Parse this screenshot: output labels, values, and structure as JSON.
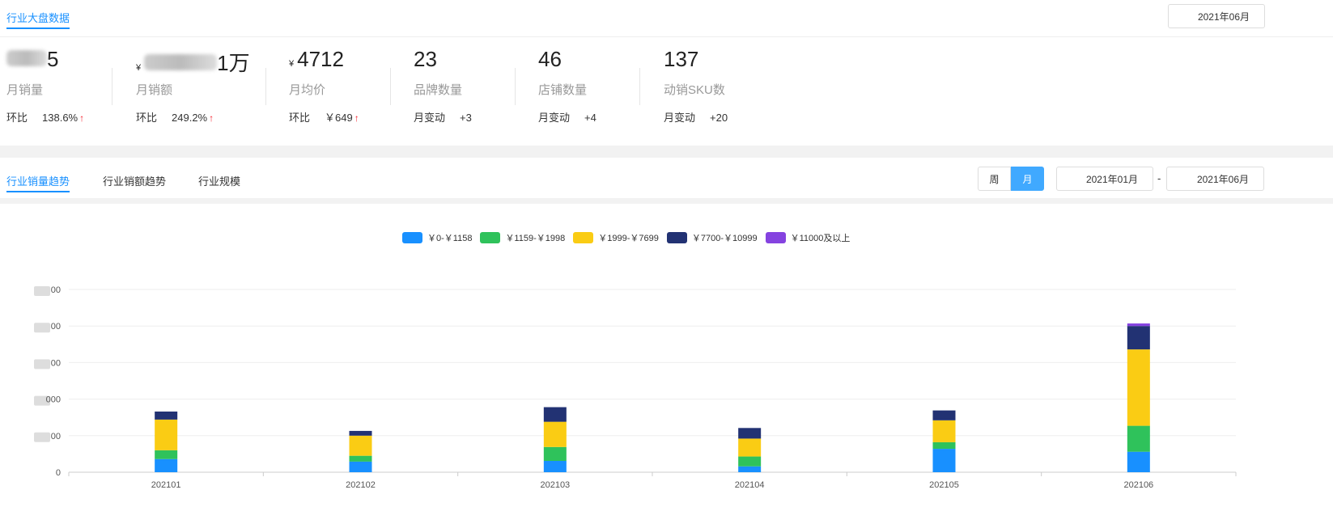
{
  "header": {
    "tab": "行业大盘数据",
    "date": "2021年06月"
  },
  "stats": [
    {
      "value_visible": "5",
      "label": "月销量",
      "sub_label": "环比",
      "sub_value": "138.6%",
      "trend": "up"
    },
    {
      "currency": "¥",
      "value_visible": "1万",
      "label": "月销额",
      "sub_label": "环比",
      "sub_value": "249.2%",
      "trend": "up"
    },
    {
      "currency": "¥",
      "value": "4712",
      "label": "月均价",
      "sub_label": "环比",
      "sub_value": "￥649",
      "trend": "up"
    },
    {
      "value": "23",
      "label": "品牌数量",
      "sub_label": "月变动",
      "sub_value": "+3"
    },
    {
      "value": "46",
      "label": "店铺数量",
      "sub_label": "月变动",
      "sub_value": "+4"
    },
    {
      "value": "137",
      "label": "动销SKU数",
      "sub_label": "月变动",
      "sub_value": "+20"
    }
  ],
  "trend": {
    "tabs": [
      "行业销量趋势",
      "行业销额趋势",
      "行业规模"
    ],
    "period": {
      "week": "周",
      "month": "月",
      "selected": "月"
    },
    "start": "2021年01月",
    "sep": "-",
    "end": "2021年06月"
  },
  "chart_data": {
    "type": "bar",
    "stacked": true,
    "categories": [
      "202101",
      "202102",
      "202103",
      "202104",
      "202105",
      "202106"
    ],
    "ytick_labels": [
      "0",
      "00",
      "000",
      "00",
      "00",
      "00"
    ],
    "ylim": [
      0,
      5
    ],
    "note": "y-axis units obscured; values in gridline units",
    "series": [
      {
        "name": "￥0-￥1158",
        "color": "#1890ff",
        "values": [
          0.36,
          0.29,
          0.31,
          0.16,
          0.64,
          0.56
        ]
      },
      {
        "name": "￥1159-￥1998",
        "color": "#2fc25b",
        "values": [
          0.24,
          0.16,
          0.38,
          0.27,
          0.18,
          0.71
        ]
      },
      {
        "name": "￥1999-￥7699",
        "color": "#facc14",
        "values": [
          0.84,
          0.55,
          0.69,
          0.49,
          0.6,
          2.09
        ]
      },
      {
        "name": "￥7700-￥10999",
        "color": "#223273",
        "values": [
          0.22,
          0.13,
          0.4,
          0.29,
          0.27,
          0.64
        ]
      },
      {
        "name": "￥11000及以上",
        "color": "#8543e0",
        "values": [
          0,
          0,
          0,
          0,
          0,
          0.07
        ]
      }
    ],
    "legend": "top-center"
  }
}
